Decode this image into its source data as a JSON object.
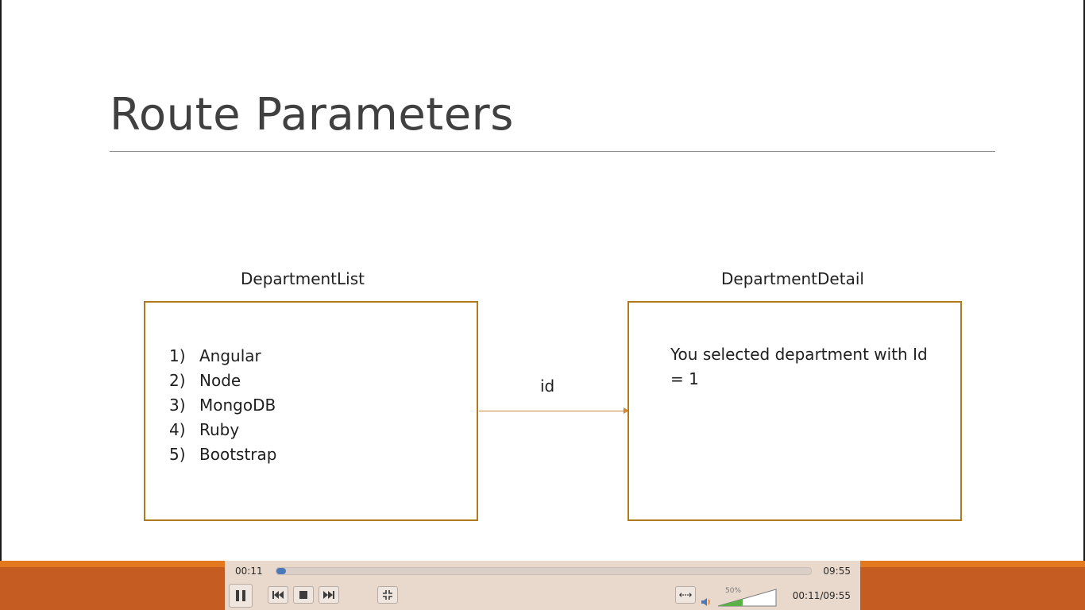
{
  "slide": {
    "title": "Route Parameters",
    "left_box": {
      "label": "DepartmentList",
      "items": [
        {
          "num": "1)",
          "text": "Angular"
        },
        {
          "num": "2)",
          "text": "Node"
        },
        {
          "num": "3)",
          "text": "MongoDB"
        },
        {
          "num": "4)",
          "text": "Ruby"
        },
        {
          "num": "5)",
          "text": "Bootstrap"
        }
      ]
    },
    "arrow_label": "id",
    "right_box": {
      "label": "DepartmentDetail",
      "text": "You selected department with Id = 1"
    }
  },
  "player": {
    "elapsed": "00:11",
    "total": "09:55",
    "combined": "00:11/09:55",
    "progress_fraction": 0.018,
    "volume_label": "50%",
    "volume_fraction": 0.5,
    "icons": {
      "pause": "pause-icon",
      "previous": "skip-previous-icon",
      "stop": "stop-icon",
      "next": "skip-next-icon",
      "fullscreen": "exit-fullscreen-icon",
      "aspect": "aspect-ratio-icon",
      "speaker": "speaker-icon"
    },
    "colors": {
      "band": "#c55d22",
      "band_light": "#e2791e",
      "controls_bg": "#e9d9cd",
      "seek_fill": "#4a78b8",
      "volume_fill": "#5cb048"
    }
  },
  "colors": {
    "box_border": "#b07a1e",
    "arrow": "#d4883a",
    "title": "#404040"
  }
}
